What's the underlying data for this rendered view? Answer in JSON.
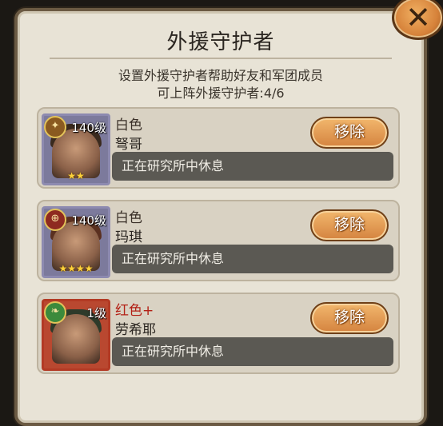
{
  "dialog": {
    "title": "外援守护者",
    "description": "设置外援守护者帮助好友和军团成员",
    "capacity": "可上阵外援守护者:4/6"
  },
  "guardians": [
    {
      "level": "140级",
      "quality": "白色",
      "name": "弩哥",
      "status": "正在研究所中休息",
      "stars": "★★",
      "remove_label": "移除"
    },
    {
      "level": "140级",
      "quality": "白色",
      "name": "玛琪",
      "status": "正在研究所中休息",
      "stars": "★★★★",
      "remove_label": "移除"
    },
    {
      "level": "1级",
      "quality": "红色+",
      "name": "劳希耶",
      "status": "正在研究所中休息",
      "stars": "",
      "remove_label": "移除"
    }
  ],
  "icons": {
    "close": "close-icon",
    "emblems": [
      "faction-orange-emblem",
      "faction-red-emblem",
      "faction-green-emblem"
    ]
  },
  "colors": {
    "panel": "#e8e3d6",
    "button": "#d4833f",
    "status_bar": "#5b5953",
    "quality_red": "#b32015"
  }
}
